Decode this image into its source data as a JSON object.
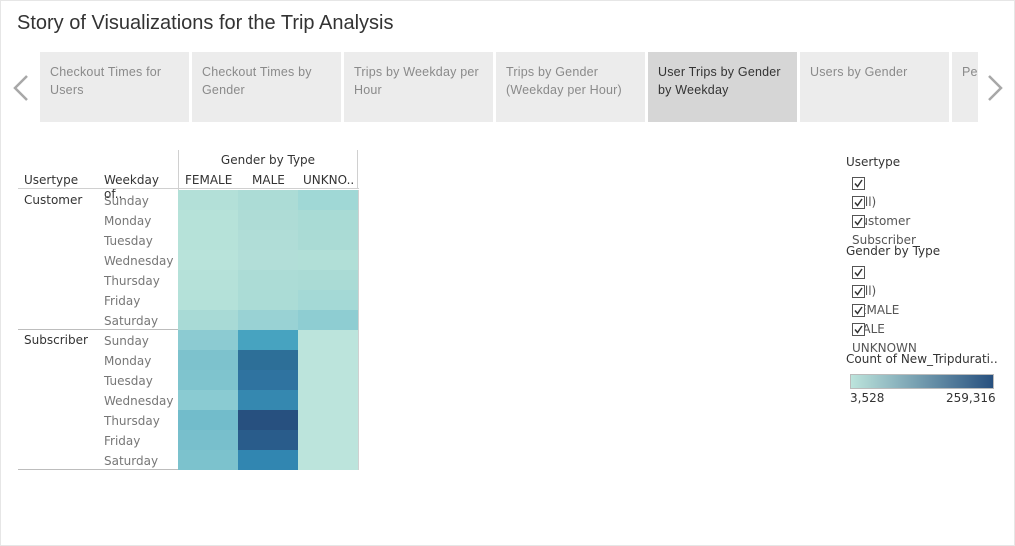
{
  "story": {
    "title": "Story of Visualizations for the Trip Analysis"
  },
  "tabs": [
    {
      "label": "Checkout Times for Users"
    },
    {
      "label": "Checkout Times by Gender"
    },
    {
      "label": "Trips by Weekday per Hour"
    },
    {
      "label": "Trips by Gender (Weekday per Hour)"
    },
    {
      "label": "User Trips by Gender by Weekday",
      "active": true
    },
    {
      "label": "Users by Gender"
    },
    {
      "label": "Pe"
    }
  ],
  "sheet": {
    "column_group_label": "Gender by Type",
    "row_header_usertype": "Usertype",
    "row_header_weekday": "Weekday of..",
    "columns": [
      "FEMALE",
      "MALE",
      "UNKNO.."
    ],
    "usertypes": [
      "Customer",
      "Subscriber"
    ],
    "weekdays": [
      "Sunday",
      "Monday",
      "Tuesday",
      "Wednesday",
      "Thursday",
      "Friday",
      "Saturday"
    ]
  },
  "heatmap_colors": {
    "Customer": [
      [
        "#b3e0d8",
        "#acdcd6",
        "#a0d8d6"
      ],
      [
        "#b6e2d9",
        "#aedcd6",
        "#a9dbd5"
      ],
      [
        "#b6e2d9",
        "#b0ddd7",
        "#aadbd5"
      ],
      [
        "#b8e3da",
        "#b2ded8",
        "#b1dfd7"
      ],
      [
        "#b5e1d9",
        "#acdcd6",
        "#aadbd5"
      ],
      [
        "#b4e1d9",
        "#abdcd6",
        "#a4d9d6"
      ],
      [
        "#a8dad6",
        "#99d2d4",
        "#8ecdd2"
      ]
    ],
    "Subscriber": [
      [
        "#8ccbd2",
        "#47a3c0",
        "#bce4dc"
      ],
      [
        "#7dc2cd",
        "#2d6f98",
        "#bce4dc"
      ],
      [
        "#7fc4ce",
        "#2f73a0",
        "#bce4dc"
      ],
      [
        "#8acbd2",
        "#3588b0",
        "#bce4dc"
      ],
      [
        "#72bccb",
        "#27507f",
        "#bce4dc"
      ],
      [
        "#78bfcc",
        "#295c8b",
        "#bce4dc"
      ],
      [
        "#7cc2cd",
        "#3186b1",
        "#bce4dc"
      ]
    ]
  },
  "filters": {
    "usertype": {
      "title": "Usertype",
      "items": [
        "(All)",
        "Customer",
        "Subscriber"
      ]
    },
    "gender": {
      "title": "Gender by Type",
      "items": [
        "(All)",
        "FEMALE",
        "MALE",
        "UNKNOWN"
      ]
    }
  },
  "color_legend": {
    "title": "Count of New_Tripdurati..",
    "min_label": "3,528",
    "max_label": "259,316",
    "color_low": "#bce4dc",
    "color_high": "#27507f"
  }
}
